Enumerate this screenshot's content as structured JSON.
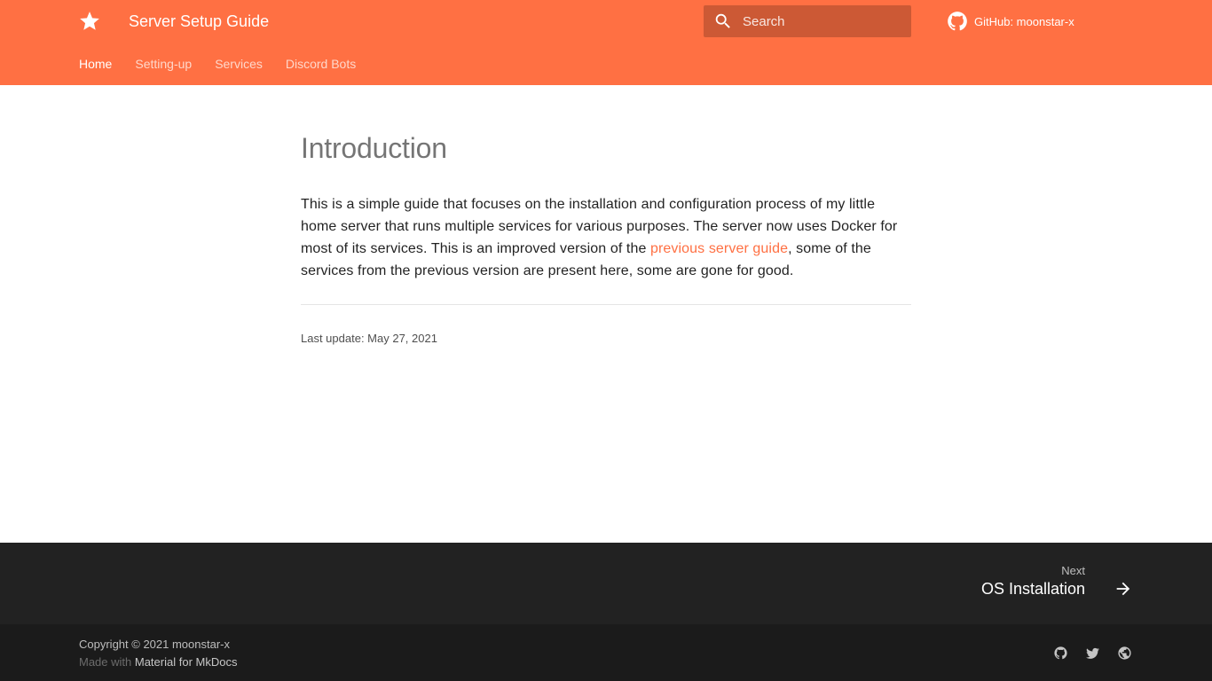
{
  "header": {
    "site_title": "Server Setup Guide",
    "logo_icon": "star-icon",
    "search_placeholder": "Search",
    "search_value": "",
    "repo_label": "GitHub: moonstar-x",
    "accent_color": "#ff7043"
  },
  "tabs": [
    {
      "label": "Home",
      "active": true
    },
    {
      "label": "Setting-up",
      "active": false
    },
    {
      "label": "Services",
      "active": false
    },
    {
      "label": "Discord Bots",
      "active": false
    }
  ],
  "main": {
    "title": "Introduction",
    "intro_part1": "This is a simple guide that focuses on the installation and configuration process of my little home server that runs multiple services for various purposes. The server now uses Docker for most of its services. This is an improved version of the ",
    "intro_link": "previous server guide",
    "intro_part2": ", some of the services from the previous version are present here, some are gone for good.",
    "last_update": "Last update: May 27, 2021"
  },
  "footer_nav": {
    "direction": "Next",
    "title": "OS Installation",
    "icon": "arrow-right-icon"
  },
  "footer_meta": {
    "copyright": "Copyright © 2021 moonstar-x",
    "made_with_prefix": "Made with ",
    "made_with_link": "Material for MkDocs",
    "social": [
      {
        "icon": "github-icon"
      },
      {
        "icon": "twitter-icon"
      },
      {
        "icon": "globe-icon"
      }
    ]
  }
}
